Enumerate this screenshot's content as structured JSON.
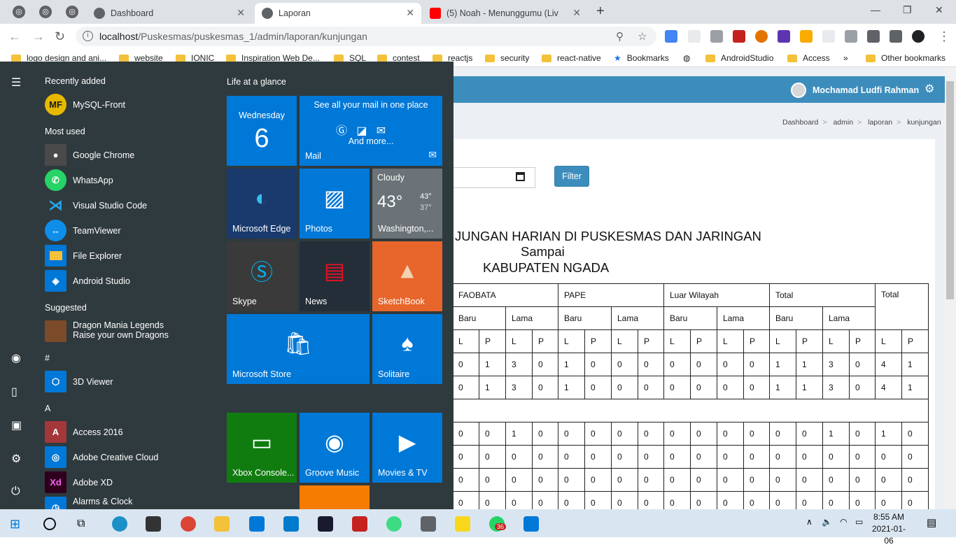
{
  "browser": {
    "tabs": [
      {
        "title": "Dashboard",
        "favicon_color": "#5f6368"
      },
      {
        "title": "Laporan",
        "favicon_color": "#5f6368"
      },
      {
        "title": "(5) Noah - Menunggumu (Liv",
        "favicon_color": "#ff0000"
      }
    ],
    "url_host": "localhost",
    "url_path": "/Puskesmas/puskesmas_1/admin/laporan/kunjungan",
    "bookmarks": [
      "logo design and ani...",
      "website",
      "IONIC",
      "Inspiration Web De...",
      "SQL",
      "contest",
      "reactjs",
      "security",
      "react-native",
      "Bookmarks",
      "AndroidStudio",
      "Access",
      "Other bookmarks"
    ],
    "more_bookmarks": "»"
  },
  "app": {
    "user_name": "Mochamad Ludfi Rahman",
    "breadcrumb": [
      "Dashboard",
      "admin",
      "laporan",
      "kunjungan"
    ],
    "filter_label": "Filter",
    "report_title_1": "JUNGAN HARIAN DI PUSKESMAS DAN JARINGAN",
    "report_title_2": "Sampai",
    "report_title_3": "KABUPATEN NGADA",
    "table": {
      "groups": [
        "FAOBATA",
        "PAPE",
        "Luar Wilayah",
        "Total",
        "Total"
      ],
      "sub": [
        "Baru",
        "Lama"
      ],
      "lp": [
        "L",
        "P"
      ],
      "rows": [
        [
          "0",
          "1",
          "3",
          "0",
          "1",
          "0",
          "0",
          "0",
          "0",
          "0",
          "0",
          "0",
          "1",
          "1",
          "3",
          "0",
          "4",
          "1"
        ],
        [
          "0",
          "1",
          "3",
          "0",
          "1",
          "0",
          "0",
          "0",
          "0",
          "0",
          "0",
          "0",
          "1",
          "1",
          "3",
          "0",
          "4",
          "1"
        ],
        null,
        [
          "0",
          "0",
          "1",
          "0",
          "0",
          "0",
          "0",
          "0",
          "0",
          "0",
          "0",
          "0",
          "0",
          "0",
          "1",
          "0",
          "1",
          "0"
        ],
        [
          "0",
          "0",
          "0",
          "0",
          "0",
          "0",
          "0",
          "0",
          "0",
          "0",
          "0",
          "0",
          "0",
          "0",
          "0",
          "0",
          "0",
          "0"
        ],
        [
          "0",
          "0",
          "0",
          "0",
          "0",
          "0",
          "0",
          "0",
          "0",
          "0",
          "0",
          "0",
          "0",
          "0",
          "0",
          "0",
          "0",
          "0"
        ],
        [
          "0",
          "0",
          "0",
          "0",
          "0",
          "0",
          "0",
          "0",
          "0",
          "0",
          "0",
          "0",
          "0",
          "0",
          "0",
          "0",
          "0",
          "0"
        ]
      ]
    }
  },
  "start_menu": {
    "recently_added_label": "Recently added",
    "recent": [
      {
        "name": "MySQL-Front",
        "icon": "MF",
        "color": "#e6b800"
      }
    ],
    "most_used_label": "Most used",
    "most_used": [
      {
        "name": "Google Chrome",
        "icon": "chrome-icon",
        "color": "#4a4a4a"
      },
      {
        "name": "WhatsApp",
        "icon": "whatsapp-icon",
        "color": "#25d366"
      },
      {
        "name": "Visual Studio Code",
        "icon": "vscode-icon",
        "color": "#2f3a3e"
      },
      {
        "name": "TeamViewer",
        "icon": "teamviewer-icon",
        "color": "#0e8ee9"
      },
      {
        "name": "File Explorer",
        "icon": "folder-icon",
        "color": "#0078d7"
      },
      {
        "name": "Android Studio",
        "icon": "android-studio-icon",
        "color": "#0078d7"
      }
    ],
    "suggested_label": "Suggested",
    "suggested": {
      "name": "Dragon Mania Legends",
      "sub": "Raise your own Dragons"
    },
    "hash_label": "#",
    "hash_apps": [
      {
        "name": "3D Viewer",
        "color": "#0078d7"
      }
    ],
    "a_label": "A",
    "a_apps": [
      {
        "name": "Access 2016",
        "icon": "A",
        "color": "#a4373a"
      },
      {
        "name": "Adobe Creative Cloud",
        "icon": "cc-icon",
        "color": "#0078d7"
      },
      {
        "name": "Adobe XD",
        "icon": "Xd",
        "color": "#2e001e"
      },
      {
        "name": "Alarms & Clock",
        "icon": "clock-icon",
        "color": "#0078d7"
      }
    ],
    "life_label": "Life at a glance",
    "calendar": {
      "day": "Wednesday",
      "date": "6"
    },
    "mail": {
      "headline": "See all your mail in one place",
      "more": "And more...",
      "label": "Mail"
    },
    "weather": {
      "cond": "Cloudy",
      "temp": "43°",
      "hi": "43°",
      "lo": "37°",
      "loc": "Washington,..."
    },
    "tiles": [
      "Microsoft Edge",
      "Photos",
      "Skype",
      "News",
      "SketchBook",
      "Microsoft Store",
      "Solitaire",
      "Xbox Console...",
      "Groove Music",
      "Movies & TV"
    ]
  },
  "taskbar": {
    "time": "8:55 AM",
    "date": "2021-01-06",
    "whatsapp_badge": "36"
  }
}
